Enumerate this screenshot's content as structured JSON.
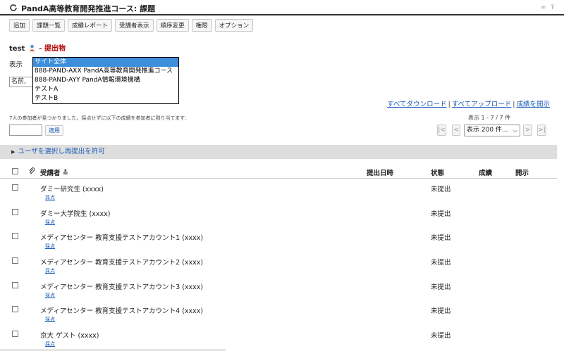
{
  "header": {
    "title": "PandA高等教育開発推進コース: 課題",
    "icons": "∞ ?"
  },
  "toolbar": [
    "追加",
    "課題一覧",
    "成績レポート",
    "受講者表示",
    "順序変更",
    "権限",
    "オプション"
  ],
  "assignment": {
    "name": "test",
    "section": "提出物"
  },
  "filter": {
    "show_label": "表示",
    "options": [
      "サイト全体",
      "888-PAND-AXX PandA高等教育開発推進コース",
      "888-PAND-AYY PandA情報環境機構",
      "テストA",
      "テストB"
    ],
    "name_input": "名前, "
  },
  "links": {
    "download_all": "すべてダウンロード",
    "upload_all": "すべてアップロード",
    "release_grades": "成績を開示",
    "sep": "|"
  },
  "grading": {
    "hint": "7人の参加者が見つかりました。採点せずに以下の成績を参加者に割り当てます:",
    "apply": "適用",
    "count": "表示 1 - 7 / 7 件",
    "page_size": "表示 200 件...",
    "pager": {
      "first": "|<",
      "prev": "<",
      "next": ">",
      "last": ">|"
    }
  },
  "resubmit": {
    "label": "ユーザを選択し再提出を許可"
  },
  "table": {
    "columns": {
      "student": "受講者 ≛",
      "submitted": "提出日時",
      "status": "状態",
      "grade": "成績",
      "release": "開示"
    },
    "grade_link": "採点",
    "rows": [
      {
        "name": "ダミー研究生 (xxxx)",
        "status": "未提出"
      },
      {
        "name": "ダミー大学院生 (xxxx)",
        "status": "未提出"
      },
      {
        "name": "メディアセンター 教育支援テストアカウント1 (xxxx)",
        "status": "未提出"
      },
      {
        "name": "メディアセンター 教育支援テストアカウント2 (xxxx)",
        "status": "未提出"
      },
      {
        "name": "メディアセンター 教育支援テストアカウント3 (xxxx)",
        "status": "未提出"
      },
      {
        "name": "メディアセンター 教育支援テストアカウント4 (xxxx)",
        "status": "未提出"
      },
      {
        "name": "京大 ゲスト (xxxx)",
        "status": "未提出"
      }
    ]
  },
  "colors": {
    "accent": "#3d8fdc",
    "link": "#1a5bb5",
    "red": "#b30000"
  }
}
